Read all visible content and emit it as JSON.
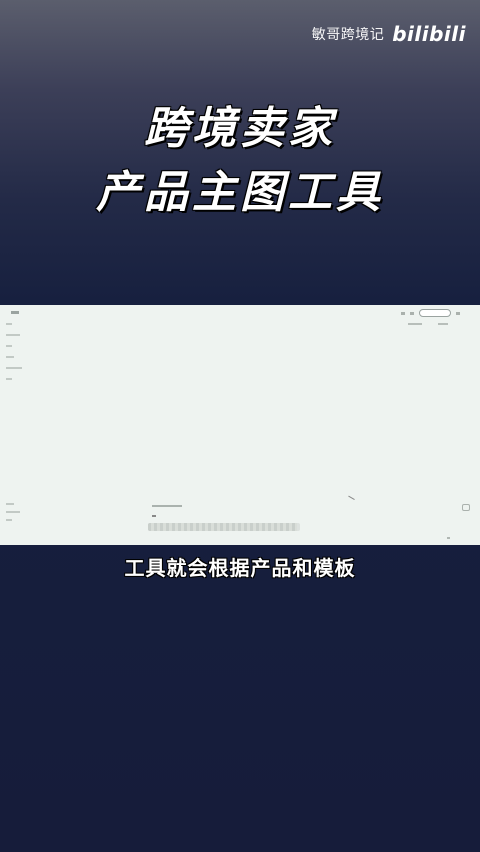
{
  "watermark": {
    "author": "敏哥跨境记",
    "logo_text": "bilibili"
  },
  "title": {
    "line1": "跨境卖家",
    "line2": "产品主图工具"
  },
  "subtitle": "工具就会根据产品和模板",
  "screen": {
    "progress": 0.98,
    "icons": [
      "more-icon",
      "search-pill-icon",
      "chat-icon",
      "cursor-icon"
    ]
  },
  "colors": {
    "screen_bg": "#eef3f0",
    "page_bg_top": "#5b5e6d",
    "page_bg_bottom": "#161c3a",
    "text": "#ffffff"
  }
}
